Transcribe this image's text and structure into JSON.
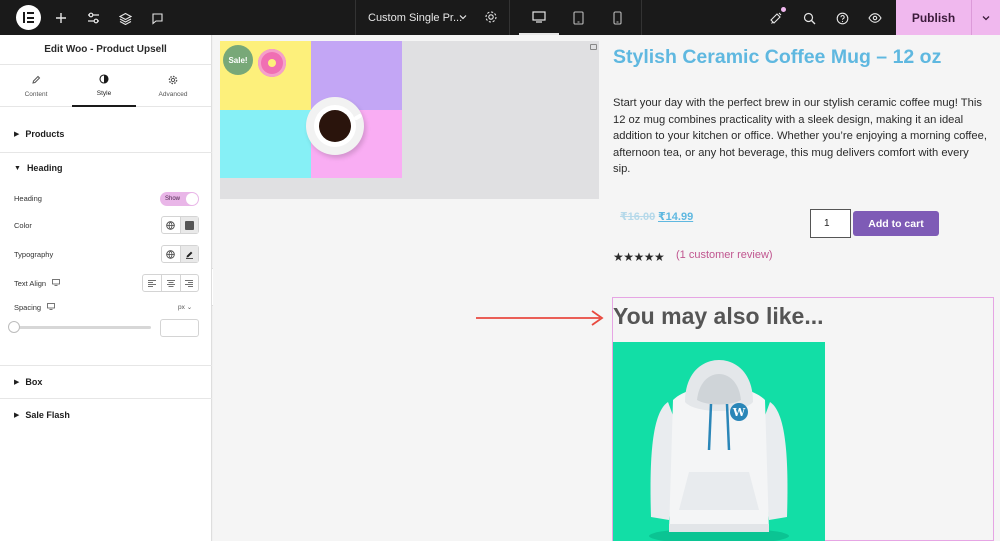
{
  "topbar": {
    "document_title": "Custom Single Pr...",
    "publish_label": "Publish",
    "icons": [
      "elementor-logo-icon",
      "plus-icon",
      "sliders-icon",
      "layers-icon",
      "comment-icon",
      "gear-icon",
      "desktop-icon",
      "tablet-icon",
      "mobile-icon",
      "notifications-icon",
      "search-icon",
      "help-icon",
      "preview-eye-icon",
      "chevron-down-icon"
    ]
  },
  "panel": {
    "title": "Edit Woo - Product Upsell",
    "tabs": [
      {
        "label": "Content",
        "icon": "pencil-icon"
      },
      {
        "label": "Style",
        "icon": "half-circle-icon"
      },
      {
        "label": "Advanced",
        "icon": "gear-icon"
      }
    ],
    "active_tab": "Style",
    "sections": {
      "products": "Products",
      "heading": "Heading",
      "box": "Box",
      "sale_flash": "Sale Flash"
    },
    "controls": {
      "heading_label": "Heading",
      "heading_toggle": "Show",
      "color_label": "Color",
      "typography_label": "Typography",
      "text_align_label": "Text Align",
      "spacing_label": "Spacing",
      "spacing_unit": "px",
      "spacing_value": "",
      "spacing_slider": 0
    }
  },
  "product": {
    "sale_badge": "Sale!",
    "title": "Stylish Ceramic Coffee Mug – 12 oz",
    "description": "Start your day with the perfect brew in our stylish ceramic coffee mug! This 12 oz mug combines practicality with a sleek design, making it an ideal addition to your kitchen or office. Whether you’re enjoying a morning coffee, afternoon tea, or any hot beverage, this mug delivers comfort with every sip.",
    "old_price": "₹16.00",
    "new_price": "₹14.99",
    "quantity": "1",
    "add_to_cart": "Add to cart",
    "rating": 5,
    "stars": "★★★★★",
    "reviews_link": "(1 customer review)"
  },
  "upsell": {
    "heading": "You may also like..."
  },
  "colors": {
    "accent_pink": "#f0b8ee",
    "title_blue": "#5fb8e0",
    "cart_purple": "#7e5bb6",
    "review_pink": "#c0558f",
    "arrow_red": "#e8493f",
    "hoodie_bg": "#12dea6"
  }
}
